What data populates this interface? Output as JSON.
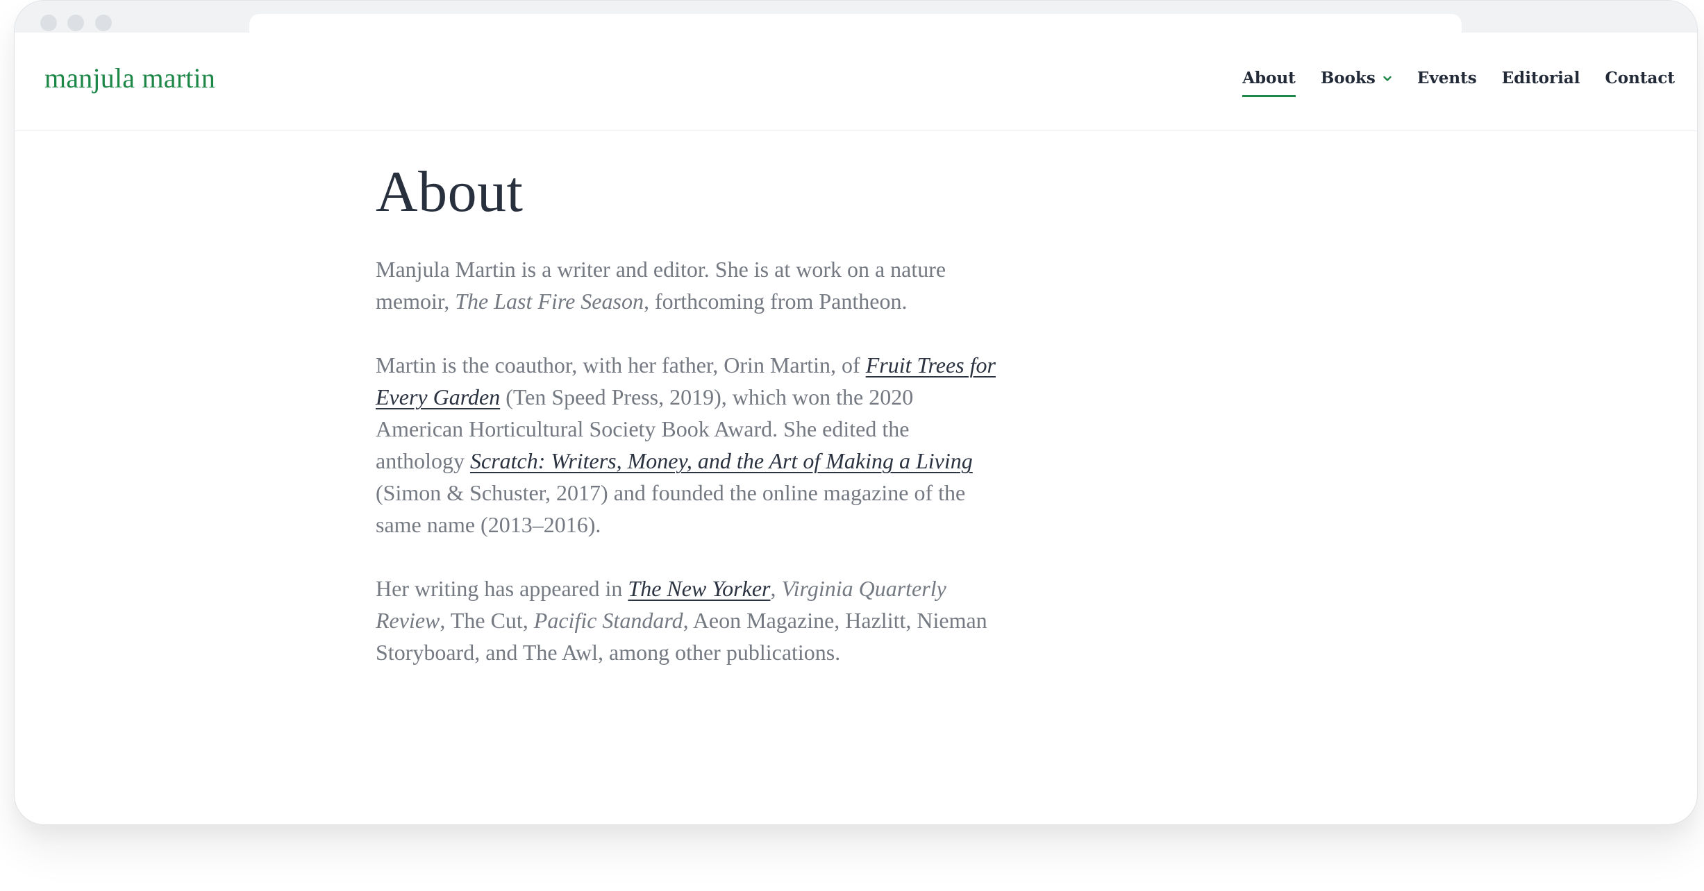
{
  "browser": {
    "window_dots": [
      "close",
      "minimize",
      "maximize"
    ]
  },
  "site": {
    "title": "manjula martin"
  },
  "nav": {
    "items": [
      {
        "label": "About",
        "active": true
      },
      {
        "label": "Books",
        "has_dropdown": true
      },
      {
        "label": "Events"
      },
      {
        "label": "Editorial"
      },
      {
        "label": "Contact"
      }
    ]
  },
  "page": {
    "title": "About",
    "p1": {
      "t1": "Manjula Martin is a writer and editor. She is at work on a nature memoir, ",
      "em1": "The Last Fire Season",
      "t2": ", forthcoming from Pantheon."
    },
    "p2": {
      "t1": "Martin is the coauthor, with her father, Orin Martin, of ",
      "link1": "Fruit Trees for Every Garden",
      "t2": " (Ten Speed Press, 2019), which won the 2020 American Horticultural Society Book Award. She edited the anthology ",
      "link2": "Scratch: Writers, Money, and the Art of Making a Living ",
      "t3": "(Simon & Schuster, 2017) and founded the online magazine of the same name (2013–2016)."
    },
    "p3": {
      "t1": "Her writing has appeared in ",
      "link1": "The New Yorker",
      "t2": ", ",
      "em1": "Virginia Quarterly Review",
      "t3": ", The Cut, ",
      "em2": "Pacific Standard",
      "t4": ", Aeon Magazine, Hazlitt, Nieman Storyboard, and The Awl, among other publications."
    }
  },
  "colors": {
    "brand_green": "#1d8748",
    "heading": "#28303e",
    "body_text": "#747982",
    "link": "#2b3240"
  }
}
